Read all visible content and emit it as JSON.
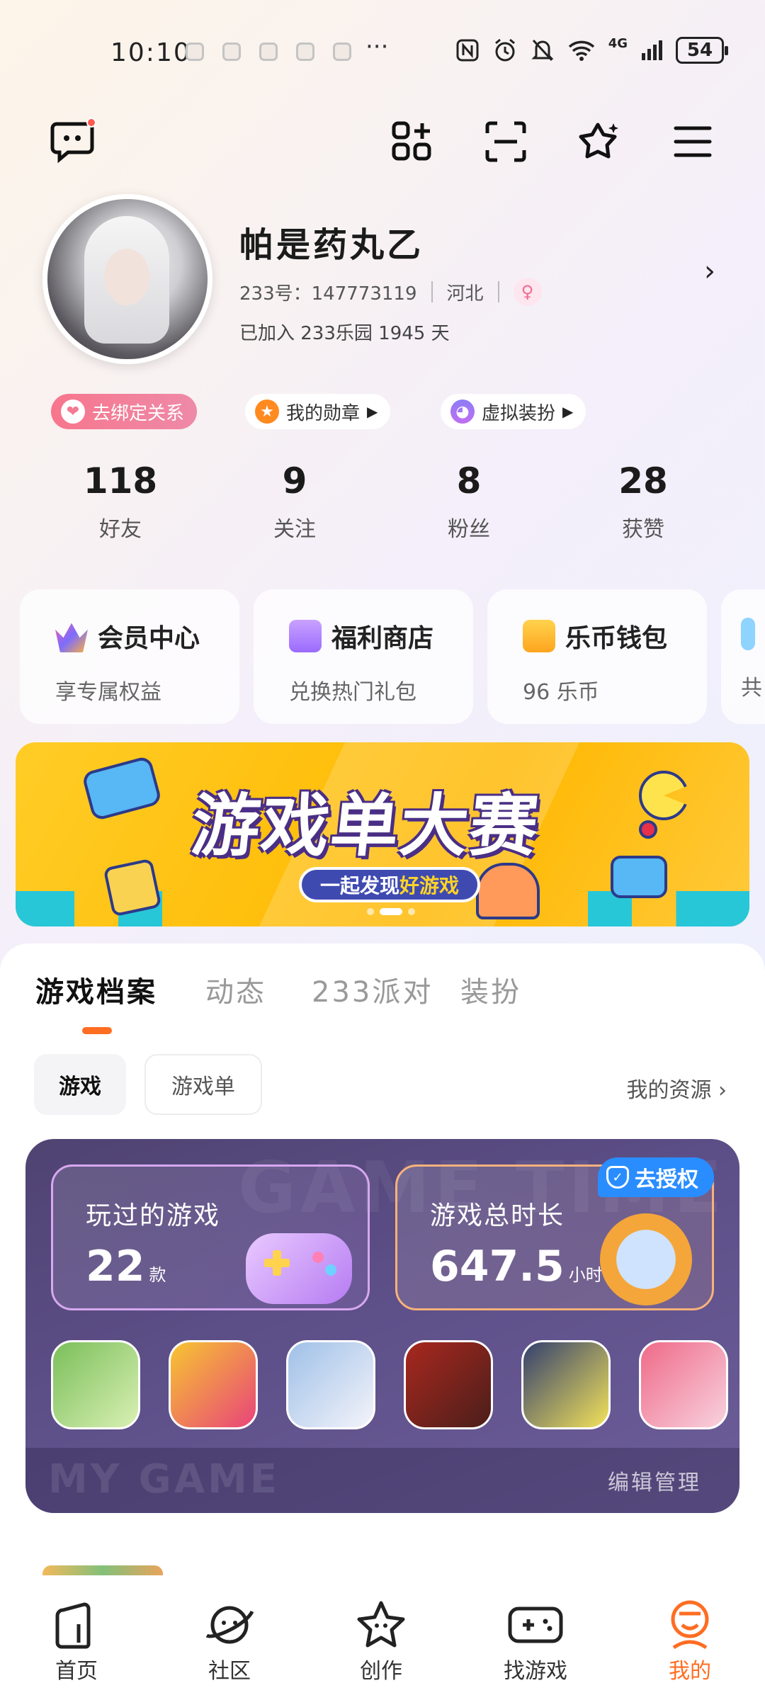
{
  "status_bar": {
    "time": "10:10",
    "more": "···",
    "network": "4G",
    "battery": "54"
  },
  "profile": {
    "name": "帕是药丸乙",
    "id_label": "233号：147773119",
    "region": "河北",
    "joined": "已加入 233乐园 1945 天"
  },
  "chips": [
    {
      "label": "去绑定关系"
    },
    {
      "label": "我的勋章"
    },
    {
      "label": "虚拟装扮"
    }
  ],
  "stats": [
    {
      "value": "118",
      "label": "好友"
    },
    {
      "value": "9",
      "label": "关注"
    },
    {
      "value": "8",
      "label": "粉丝"
    },
    {
      "value": "28",
      "label": "获赞"
    }
  ],
  "cards": [
    {
      "title": "会员中心",
      "subtitle": "享专属权益"
    },
    {
      "title": "福利商店",
      "subtitle": "兑换热门礼包"
    },
    {
      "title": "乐币钱包",
      "subtitle": "96 乐币"
    },
    {
      "title": "",
      "subtitle": "共"
    }
  ],
  "banner": {
    "title": "游戏单大赛",
    "subtitle_a": "一起发现",
    "subtitle_b": "好游戏"
  },
  "tabs": [
    {
      "label": "游戏档案"
    },
    {
      "label": "动态"
    },
    {
      "label": "233派对"
    },
    {
      "label": "装扮"
    }
  ],
  "filters": {
    "game": "游戏",
    "list": "游戏单",
    "resources": "我的资源"
  },
  "game_stats": {
    "watermark": "GAME TIME",
    "played_label": "玩过的游戏",
    "played_value": "22",
    "played_unit": "款",
    "duration_label": "游戏总时长",
    "duration_value": "647.5",
    "duration_unit": "小时",
    "auth_label": "去授权",
    "footer_mark": "MY GAME",
    "edit_label": "编辑管理"
  },
  "game_icons": [
    {
      "name": "green-block-game-icon",
      "color_a": "#7bbf5a",
      "color_b": "#d9f0b4"
    },
    {
      "name": "among-us-girl-game-icon",
      "color_a": "#f7c531",
      "color_b": "#e8447a"
    },
    {
      "name": "anime-silver-girl-game-icon",
      "color_a": "#9fc0e8",
      "color_b": "#f4f4fa"
    },
    {
      "name": "red-hood-game-icon",
      "color_a": "#a8281f",
      "color_b": "#4b1e1a"
    },
    {
      "name": "yellow-eggy-game-icon",
      "color_a": "#33406e",
      "color_b": "#f3e25a"
    },
    {
      "name": "sakura-school-game-icon",
      "color_a": "#ef6a88",
      "color_b": "#f8d2df"
    }
  ],
  "nav": [
    {
      "label": "首页"
    },
    {
      "label": "社区"
    },
    {
      "label": "创作"
    },
    {
      "label": "找游戏"
    },
    {
      "label": "我的"
    }
  ],
  "colors": {
    "accent": "#ff6d22",
    "auth_blue": "#2a8dff"
  }
}
